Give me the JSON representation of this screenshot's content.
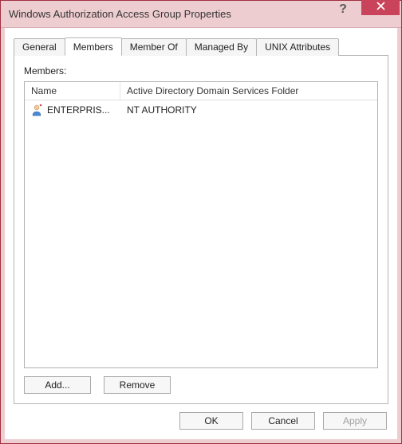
{
  "window": {
    "title": "Windows Authorization Access Group Properties"
  },
  "tabs": {
    "general": "General",
    "members": "Members",
    "member_of": "Member Of",
    "managed_by": "Managed By",
    "unix_attributes": "UNIX Attributes",
    "active": "members"
  },
  "members_panel": {
    "label": "Members:",
    "columns": {
      "name": "Name",
      "folder": "Active Directory Domain Services Folder"
    },
    "rows": [
      {
        "name": "ENTERPRIS...",
        "folder": "NT AUTHORITY"
      }
    ],
    "buttons": {
      "add": "Add...",
      "remove": "Remove"
    }
  },
  "dialog_buttons": {
    "ok": "OK",
    "cancel": "Cancel",
    "apply": "Apply"
  }
}
